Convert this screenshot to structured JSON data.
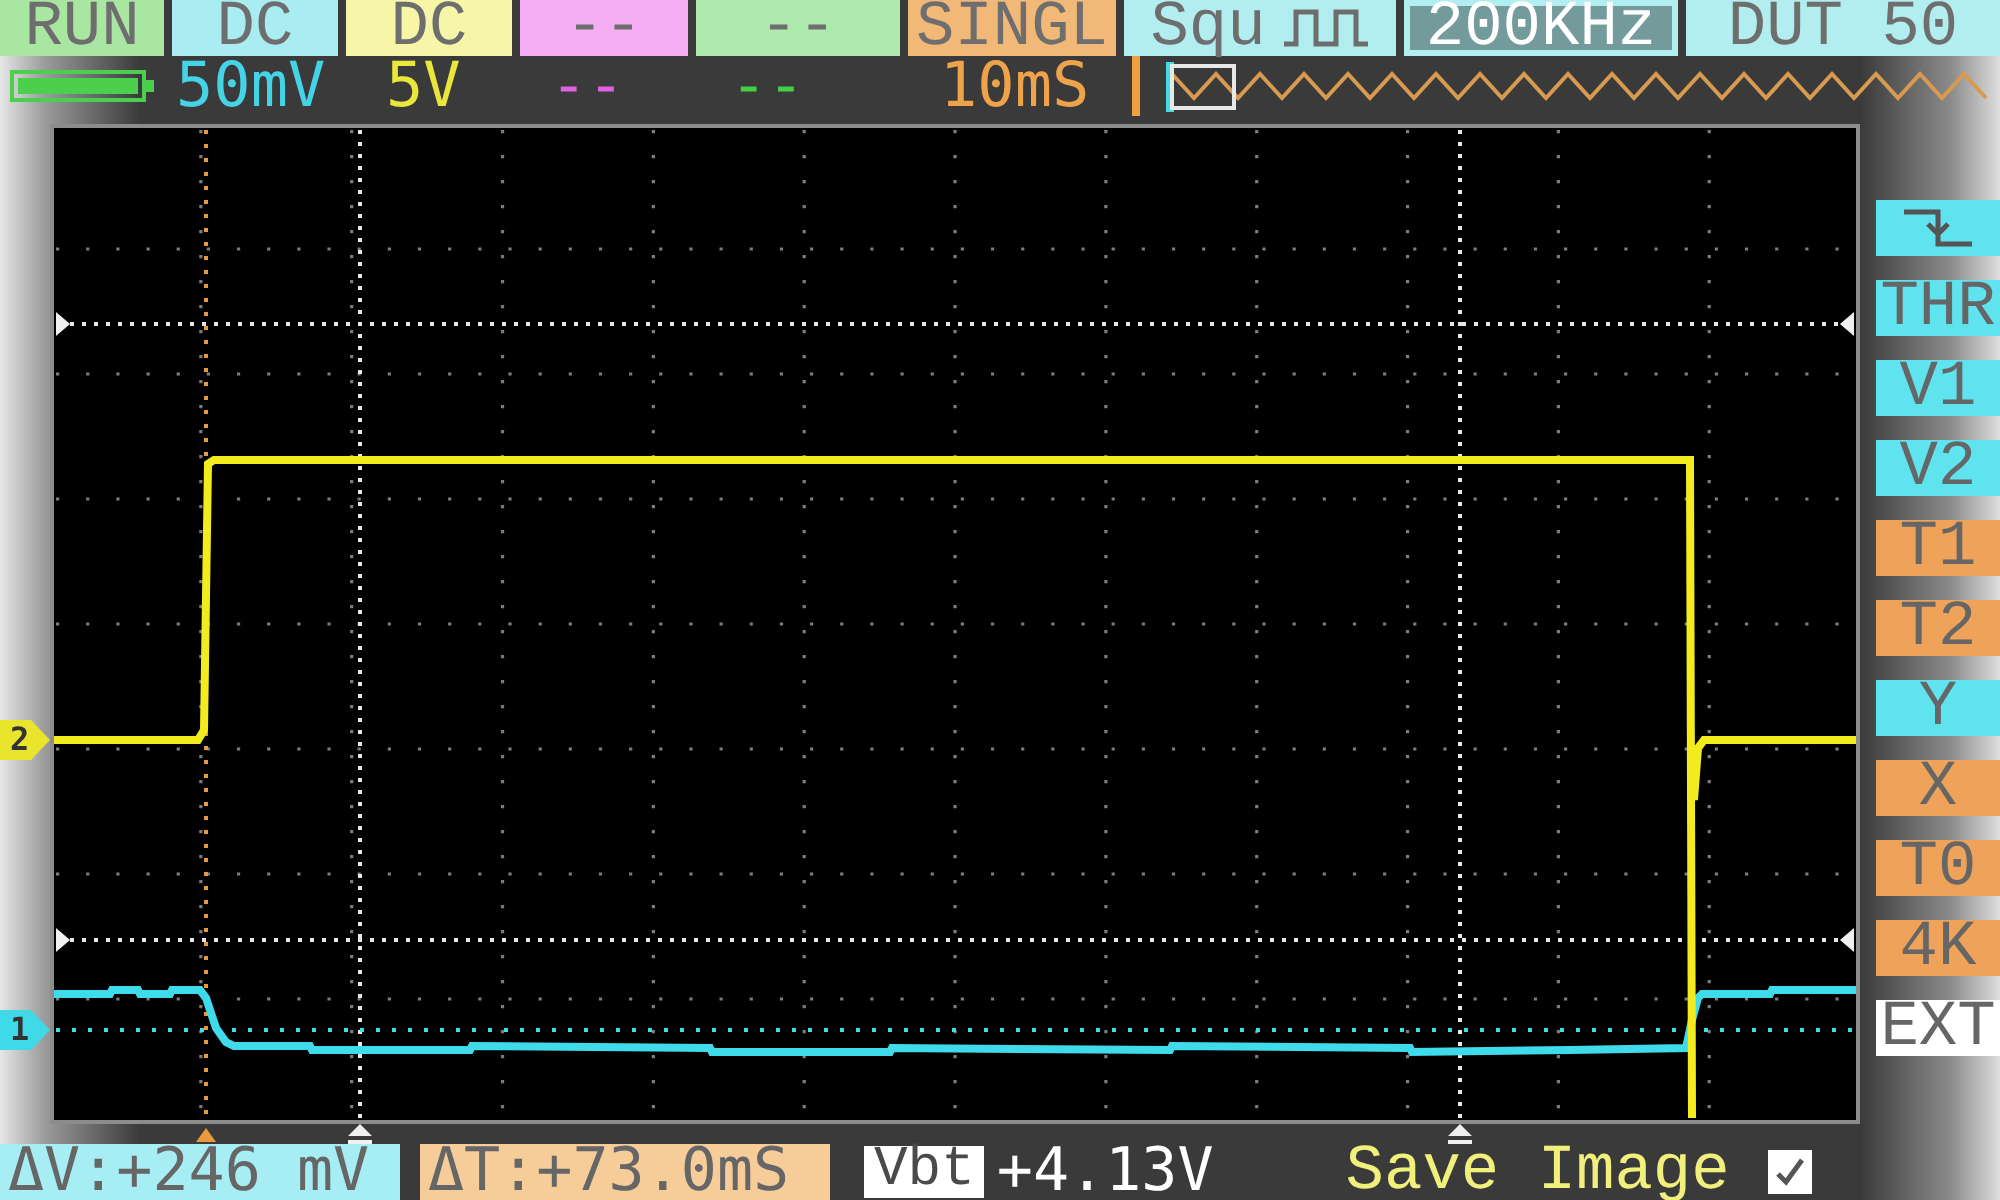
{
  "top_bar": {
    "cells": [
      {
        "kind": "text",
        "text": "RUN",
        "color": "#a9e6a2",
        "selected": false
      },
      {
        "kind": "text",
        "text": "DC",
        "color": "#a9ecf1",
        "selected": false
      },
      {
        "kind": "text",
        "text": "DC",
        "color": "#f7f5a8",
        "selected": false
      },
      {
        "kind": "text",
        "text": "--",
        "color": "#f5aef3",
        "selected": false
      },
      {
        "kind": "text",
        "text": "--",
        "color": "#aeeaae",
        "selected": false
      },
      {
        "kind": "text",
        "text": "SINGL",
        "color": "#f2b878",
        "selected": false
      },
      {
        "kind": "wave",
        "text": "Squ",
        "color": "#b2eef0",
        "selected": false
      },
      {
        "kind": "text",
        "text": "200KHz",
        "color": "#b2eef0",
        "selected": true
      },
      {
        "kind": "text",
        "text": "DUT 50",
        "color": "#b2eef0",
        "selected": false
      }
    ]
  },
  "info_bar": {
    "readings": [
      {
        "text": "50mV",
        "color": "#45d3e6"
      },
      {
        "text": "5V",
        "color": "#e9e63c"
      },
      {
        "text": "--",
        "color": "#e162e0"
      },
      {
        "text": "--",
        "color": "#41cf44"
      },
      {
        "text": "10mS",
        "color": "#eea24a"
      }
    ]
  },
  "scope": {
    "channel_markers": [
      {
        "label": "2",
        "color": "#e8e52c"
      },
      {
        "label": "1",
        "color": "#3fd9e8"
      }
    ]
  },
  "side_menu": {
    "items": [
      {
        "kind": "icon",
        "color": "#5fe3ee"
      },
      {
        "kind": "text",
        "label": "THR",
        "color": "#5fe3ee"
      },
      {
        "kind": "text",
        "label": "V1",
        "color": "#5fe3ee"
      },
      {
        "kind": "text",
        "label": "V2",
        "color": "#5fe3ee"
      },
      {
        "kind": "text",
        "label": "T1",
        "color": "#eea25a"
      },
      {
        "kind": "text",
        "label": "T2",
        "color": "#eea25a"
      },
      {
        "kind": "text",
        "label": "Y",
        "color": "#5fe3ee"
      },
      {
        "kind": "text",
        "label": "X",
        "color": "#eea25a"
      },
      {
        "kind": "text",
        "label": "T0",
        "color": "#eea25a"
      },
      {
        "kind": "text",
        "label": "4K",
        "color": "#eea25a"
      },
      {
        "kind": "text",
        "label": "EXT",
        "color": "#ffffff"
      }
    ]
  },
  "bottom_bar": {
    "measurements": [
      {
        "text": "ΔV:+246 mV",
        "color": "#a6eef4"
      },
      {
        "text": "ΔT:+73.0mS",
        "color": "#f6cc98"
      }
    ],
    "battery": {
      "label": "Vbt",
      "value": "+4.13V"
    },
    "save_image": {
      "label": "Save Image",
      "checked": true
    }
  }
}
